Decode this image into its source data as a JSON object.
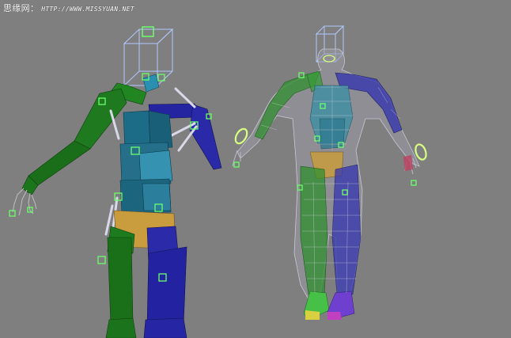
{
  "viewport": {
    "background": "#7f7f7f",
    "watermark": {
      "site_name": "思缘网：",
      "url": "HTTP://WWW.MISSYUAN.NET"
    }
  },
  "colors": {
    "left_side": "#1f7f1f",
    "right_side": "#2c2ca8",
    "torso": "#1e6e86",
    "pelvis": "#cda040",
    "bone": "#d8d8e8",
    "helper": "#6bff6b",
    "control_box": "#b0c8ff"
  },
  "objects": {
    "left_model": "box-rig",
    "right_model": "skinned-mesh"
  }
}
